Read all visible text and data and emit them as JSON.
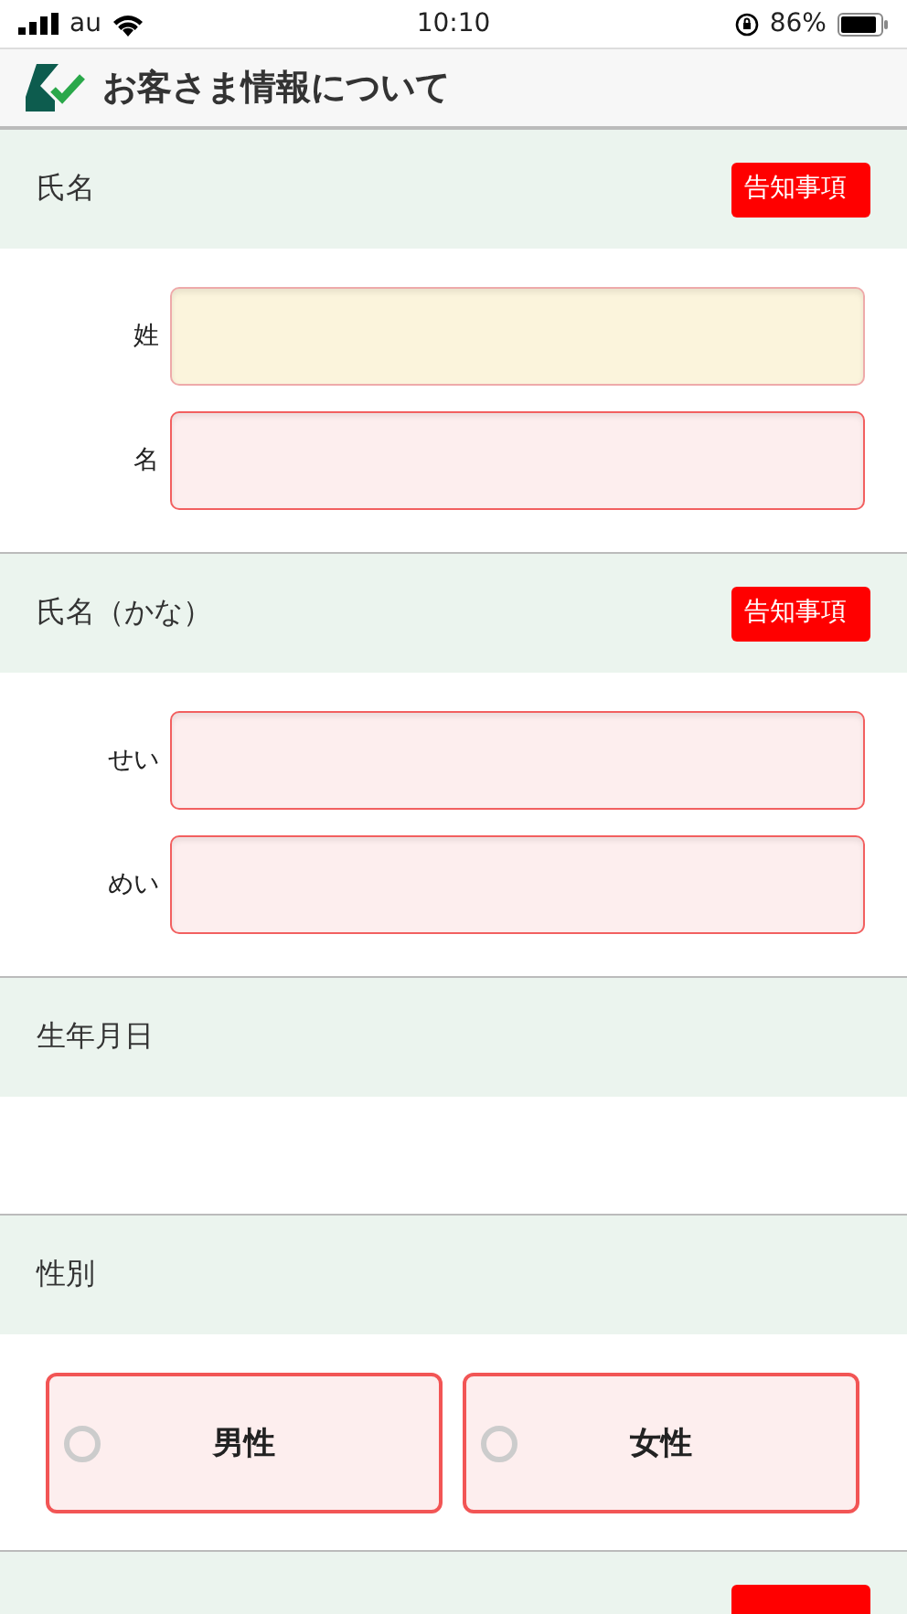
{
  "status_bar": {
    "carrier": "au",
    "time": "10:10",
    "battery": "86%"
  },
  "header": {
    "title": "お客さま情報について"
  },
  "sections": [
    {
      "kind": "fields",
      "title": "氏名",
      "badge": "告知事項",
      "fields": [
        {
          "label": "姓",
          "focused": true
        },
        {
          "label": "名",
          "focused": false
        }
      ]
    },
    {
      "kind": "fields",
      "title": "氏名（かな）",
      "badge": "告知事項",
      "fields": [
        {
          "label": "せい",
          "focused": false
        },
        {
          "label": "めい",
          "focused": false
        }
      ]
    },
    {
      "kind": "empty",
      "title": "生年月日"
    },
    {
      "kind": "radios",
      "title": "性別",
      "options": [
        {
          "label": "男性",
          "selected": false
        },
        {
          "label": "女性",
          "selected": false
        }
      ]
    },
    {
      "kind": "cut",
      "badge_shown": true
    }
  ]
}
